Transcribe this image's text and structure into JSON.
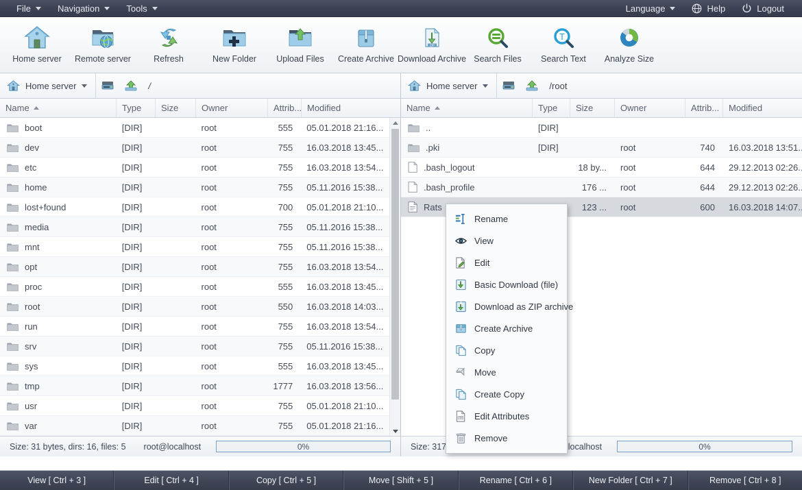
{
  "menubar": {
    "left_items": [
      {
        "label": "File",
        "icon": "chevron-down-icon"
      },
      {
        "label": "Navigation",
        "icon": "chevron-down-icon"
      },
      {
        "label": "Tools",
        "icon": "chevron-down-icon"
      }
    ],
    "right_items": [
      {
        "label": "Language",
        "icon": "chevron-down-icon"
      },
      {
        "label": "Help",
        "icon": "globe-icon"
      },
      {
        "label": "Logout",
        "icon": "power-icon"
      }
    ]
  },
  "toolbar": {
    "buttons": [
      {
        "label": "Home server",
        "icon": "home-icon"
      },
      {
        "label": "Remote server",
        "icon": "remote-server-icon"
      },
      {
        "label": "Refresh",
        "icon": "refresh-icon"
      },
      {
        "label": "New Folder",
        "icon": "new-folder-icon"
      },
      {
        "label": "Upload Files",
        "icon": "upload-icon"
      },
      {
        "label": "Create Archive",
        "icon": "create-archive-icon"
      },
      {
        "label": "Download Archive",
        "icon": "download-zip-icon"
      },
      {
        "label": "Search Files",
        "icon": "search-files-icon"
      },
      {
        "label": "Search Text",
        "icon": "search-text-icon"
      },
      {
        "label": "Analyze Size",
        "icon": "analyze-size-icon"
      }
    ]
  },
  "columns": [
    "Name",
    "Type",
    "Size",
    "Owner",
    "Attrib...",
    "Modified"
  ],
  "left_pane": {
    "server": "Home server",
    "path": "/",
    "sort_column": "Name",
    "sort_direction": "asc",
    "rows": [
      {
        "name": "boot",
        "type": "[DIR]",
        "size": "",
        "owner": "root",
        "attrib": "555",
        "modified": "05.01.2018 21:16...",
        "icon": "folder-icon"
      },
      {
        "name": "dev",
        "type": "[DIR]",
        "size": "",
        "owner": "root",
        "attrib": "755",
        "modified": "16.03.2018 13:45...",
        "icon": "folder-icon"
      },
      {
        "name": "etc",
        "type": "[DIR]",
        "size": "",
        "owner": "root",
        "attrib": "755",
        "modified": "16.03.2018 13:54...",
        "icon": "folder-icon"
      },
      {
        "name": "home",
        "type": "[DIR]",
        "size": "",
        "owner": "root",
        "attrib": "755",
        "modified": "05.11.2016 15:38...",
        "icon": "folder-icon"
      },
      {
        "name": "lost+found",
        "type": "[DIR]",
        "size": "",
        "owner": "root",
        "attrib": "700",
        "modified": "05.01.2018 21:10...",
        "icon": "folder-icon"
      },
      {
        "name": "media",
        "type": "[DIR]",
        "size": "",
        "owner": "root",
        "attrib": "755",
        "modified": "05.11.2016 15:38...",
        "icon": "folder-icon"
      },
      {
        "name": "mnt",
        "type": "[DIR]",
        "size": "",
        "owner": "root",
        "attrib": "755",
        "modified": "05.11.2016 15:38...",
        "icon": "folder-icon"
      },
      {
        "name": "opt",
        "type": "[DIR]",
        "size": "",
        "owner": "root",
        "attrib": "755",
        "modified": "16.03.2018 13:54...",
        "icon": "folder-icon"
      },
      {
        "name": "proc",
        "type": "[DIR]",
        "size": "",
        "owner": "root",
        "attrib": "555",
        "modified": "16.03.2018 13:45...",
        "icon": "folder-icon"
      },
      {
        "name": "root",
        "type": "[DIR]",
        "size": "",
        "owner": "root",
        "attrib": "550",
        "modified": "16.03.2018 14:03...",
        "icon": "folder-icon"
      },
      {
        "name": "run",
        "type": "[DIR]",
        "size": "",
        "owner": "root",
        "attrib": "755",
        "modified": "16.03.2018 13:54...",
        "icon": "folder-icon"
      },
      {
        "name": "srv",
        "type": "[DIR]",
        "size": "",
        "owner": "root",
        "attrib": "755",
        "modified": "05.11.2016 15:38...",
        "icon": "folder-icon"
      },
      {
        "name": "sys",
        "type": "[DIR]",
        "size": "",
        "owner": "root",
        "attrib": "555",
        "modified": "16.03.2018 13:45...",
        "icon": "folder-icon"
      },
      {
        "name": "tmp",
        "type": "[DIR]",
        "size": "",
        "owner": "root",
        "attrib": "1777",
        "modified": "16.03.2018 13:56...",
        "icon": "folder-icon"
      },
      {
        "name": "usr",
        "type": "[DIR]",
        "size": "",
        "owner": "root",
        "attrib": "755",
        "modified": "05.01.2018 21:10...",
        "icon": "folder-icon"
      },
      {
        "name": "var",
        "type": "[DIR]",
        "size": "",
        "owner": "root",
        "attrib": "755",
        "modified": "05.01.2018 21:16...",
        "icon": "folder-icon"
      },
      {
        "name": "",
        "type": "",
        "size": "",
        "owner": "",
        "attrib": "",
        "modified": "",
        "icon": "file-icon"
      }
    ],
    "status": {
      "size_text": "Size: 31 bytes, dirs: 16, files: 5",
      "user": "root@localhost",
      "progress": "0%"
    }
  },
  "right_pane": {
    "server": "Home server",
    "path": "/root",
    "sort_column": "Name",
    "sort_direction": "asc",
    "rows": [
      {
        "name": "..",
        "type": "[DIR]",
        "size": "",
        "owner": "",
        "attrib": "",
        "modified": "",
        "icon": "folder-icon"
      },
      {
        "name": ".pki",
        "type": "[DIR]",
        "size": "",
        "owner": "root",
        "attrib": "740",
        "modified": "16.03.2018 13:51...",
        "icon": "folder-icon"
      },
      {
        "name": ".bash_logout",
        "type": "",
        "size": "18 by...",
        "owner": "root",
        "attrib": "644",
        "modified": "29.12.2013 02:26...",
        "icon": "file-icon"
      },
      {
        "name": ".bash_profile",
        "type": "",
        "size": "176 ...",
        "owner": "root",
        "attrib": "644",
        "modified": "29.12.2013 02:26...",
        "icon": "file-icon"
      },
      {
        "name": "Rats",
        "type": "",
        "size": "123 ...",
        "owner": "root",
        "attrib": "600",
        "modified": "16.03.2018 14:07...",
        "icon": "text-file-icon",
        "selected": true
      }
    ],
    "status": {
      "size_text": "Size: 317 bytes, dirs: 1, files: 3",
      "user": "root@localhost",
      "progress": "0%"
    }
  },
  "context_menu": {
    "items": [
      {
        "label": "Rename",
        "icon": "rename-icon"
      },
      {
        "label": "View",
        "icon": "eye-icon"
      },
      {
        "label": "Edit",
        "icon": "edit-icon"
      },
      {
        "label": "Basic Download (file)",
        "icon": "download-icon"
      },
      {
        "label": "Download as ZIP archive",
        "icon": "download-zip-icon"
      },
      {
        "label": "Create Archive",
        "icon": "archive-icon"
      },
      {
        "label": "Copy",
        "icon": "copy-icon"
      },
      {
        "label": "Move",
        "icon": "move-icon"
      },
      {
        "label": "Create Copy",
        "icon": "create-copy-icon"
      },
      {
        "label": "Edit Attributes",
        "icon": "attributes-icon"
      },
      {
        "label": "Remove",
        "icon": "trash-icon"
      }
    ]
  },
  "function_bar": {
    "buttons": [
      {
        "label": "View [ Ctrl + 3 ]"
      },
      {
        "label": "Edit [ Ctrl + 4 ]"
      },
      {
        "label": "Copy [ Ctrl + 5 ]"
      },
      {
        "label": "Move [ Shift + 5 ]"
      },
      {
        "label": "Rename [ Ctrl + 6 ]"
      },
      {
        "label": "New Folder [ Ctrl + 7 ]"
      },
      {
        "label": "Remove [ Ctrl + 8 ]"
      }
    ]
  },
  "colors": {
    "menubar_bg": "#3d4353",
    "accent_blue": "#4a90c8",
    "selection": "#d6d9dd",
    "folder": "#b9bfc7"
  }
}
